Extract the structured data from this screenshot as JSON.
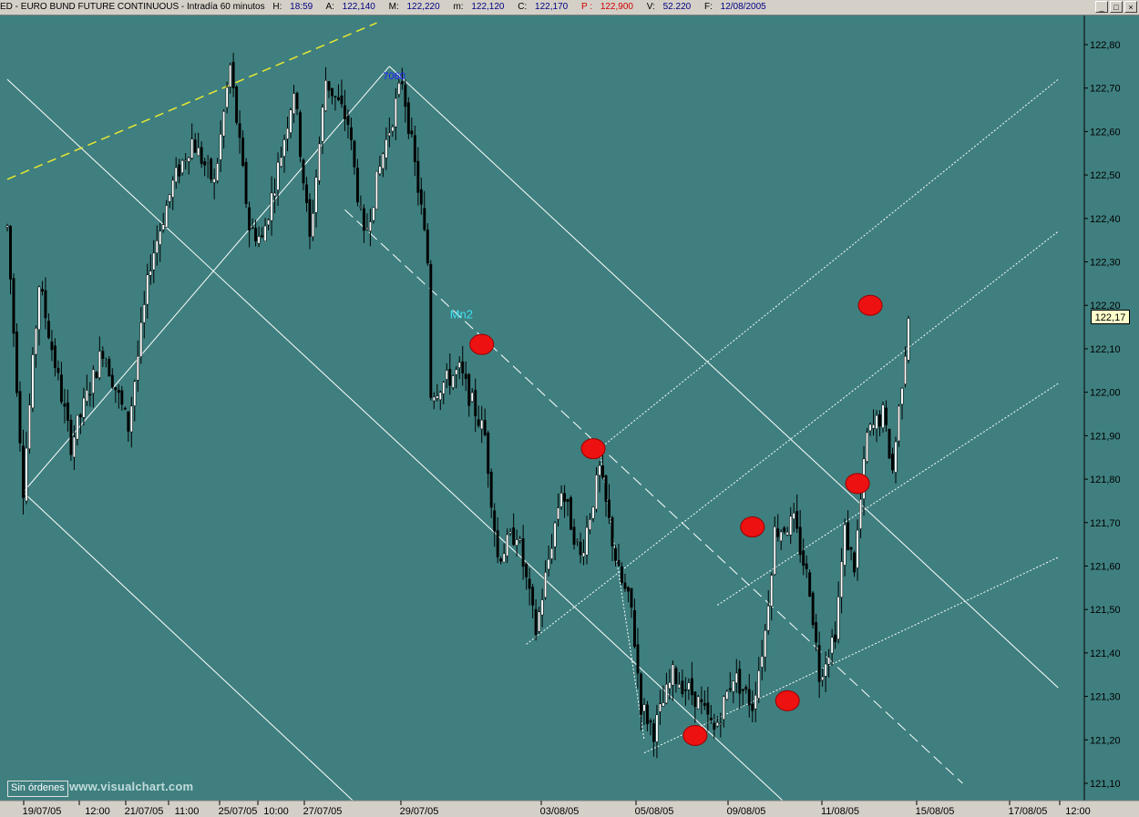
{
  "header": {
    "symbol": "ED - EURO BUND FUTURE CONTINUOUS - Intradía 60 minutos",
    "h_label": "H:",
    "h_value": "18:59",
    "a_label": "A:",
    "a_value": "122,140",
    "m_label": "M:",
    "m_value": "122,220",
    "mi_label": "m:",
    "mi_value": "122,120",
    "c_label": "C:",
    "c_value": "122,170",
    "p_label": "P :",
    "p_value": "122,900",
    "v_label": "V:",
    "v_value": "52.220",
    "f_label": "F:",
    "f_value": "12/08/2005"
  },
  "window_buttons": {
    "minimize": "_",
    "maximize": "□",
    "close": "×"
  },
  "footer": {
    "orders_button": "Sin órdenes",
    "watermark": "www.visualchart.com"
  },
  "last_price_tag": "122,17",
  "colors": {
    "background": "#3f7f7f",
    "candle_up": "#ffffff",
    "candle_down": "#000000",
    "channel_lines": "#ffffff",
    "yellow_line": "#e8e830",
    "marker": "#ee1111",
    "annotation": "#40e0f0",
    "pivot_label": "#2020ff"
  },
  "chart_data": {
    "type": "candlestick",
    "y_axis": {
      "min": 121.07,
      "max": 122.87,
      "ticks": [
        "122,80",
        "122,70",
        "122,60",
        "122,50",
        "122,40",
        "122,30",
        "122,20",
        "122,10",
        "122,00",
        "121,90",
        "121,80",
        "121,70",
        "121,60",
        "121,50",
        "121,40",
        "121,30",
        "121,20",
        "121,10"
      ]
    },
    "x_axis": {
      "ticks": [
        "19/07/05",
        "12:00",
        "21/07/05",
        "11:00",
        "25/07/05",
        "10:00",
        "27/07/05",
        "29/07/05",
        "03/08/05",
        "05/08/05",
        "09/08/05",
        "11/08/05",
        "15/08/05",
        "17/08/05",
        "12:00"
      ]
    },
    "trend_path": [
      {
        "bar": 0,
        "p": 122.38
      },
      {
        "bar": 5,
        "p": 121.78
      },
      {
        "bar": 10,
        "p": 122.25
      },
      {
        "bar": 20,
        "p": 121.88
      },
      {
        "bar": 30,
        "p": 122.1
      },
      {
        "bar": 38,
        "p": 121.92
      },
      {
        "bar": 45,
        "p": 122.3
      },
      {
        "bar": 52,
        "p": 122.48
      },
      {
        "bar": 58,
        "p": 122.58
      },
      {
        "bar": 65,
        "p": 122.48
      },
      {
        "bar": 70,
        "p": 122.75
      },
      {
        "bar": 76,
        "p": 122.38
      },
      {
        "bar": 80,
        "p": 122.35
      },
      {
        "bar": 86,
        "p": 122.55
      },
      {
        "bar": 90,
        "p": 122.7
      },
      {
        "bar": 95,
        "p": 122.35
      },
      {
        "bar": 100,
        "p": 122.72
      },
      {
        "bar": 107,
        "p": 122.62
      },
      {
        "bar": 112,
        "p": 122.35
      },
      {
        "bar": 118,
        "p": 122.55
      },
      {
        "bar": 124,
        "p": 122.72
      },
      {
        "bar": 130,
        "p": 122.42
      },
      {
        "bar": 132,
        "p": 122.3
      },
      {
        "bar": 133,
        "p": 122.0
      },
      {
        "bar": 142,
        "p": 122.05
      },
      {
        "bar": 150,
        "p": 121.9
      },
      {
        "bar": 154,
        "p": 121.62
      },
      {
        "bar": 160,
        "p": 121.68
      },
      {
        "bar": 166,
        "p": 121.45
      },
      {
        "bar": 174,
        "p": 121.78
      },
      {
        "bar": 180,
        "p": 121.62
      },
      {
        "bar": 186,
        "p": 121.82
      },
      {
        "bar": 192,
        "p": 121.58
      },
      {
        "bar": 196,
        "p": 121.5
      },
      {
        "bar": 199,
        "p": 121.28
      },
      {
        "bar": 203,
        "p": 121.22
      },
      {
        "bar": 209,
        "p": 121.35
      },
      {
        "bar": 216,
        "p": 121.3
      },
      {
        "bar": 222,
        "p": 121.22
      },
      {
        "bar": 228,
        "p": 121.35
      },
      {
        "bar": 234,
        "p": 121.28
      },
      {
        "bar": 238,
        "p": 121.45
      },
      {
        "bar": 241,
        "p": 121.68
      },
      {
        "bar": 247,
        "p": 121.7
      },
      {
        "bar": 252,
        "p": 121.55
      },
      {
        "bar": 255,
        "p": 121.35
      },
      {
        "bar": 260,
        "p": 121.45
      },
      {
        "bar": 263,
        "p": 121.68
      },
      {
        "bar": 266,
        "p": 121.6
      },
      {
        "bar": 270,
        "p": 121.9
      },
      {
        "bar": 275,
        "p": 121.95
      },
      {
        "bar": 278,
        "p": 121.82
      },
      {
        "bar": 283,
        "p": 122.17
      }
    ],
    "bar_count": 284,
    "seed": 7,
    "channel_lines": [
      {
        "style": "solid",
        "p1": {
          "bar": 5,
          "p": 121.77
        },
        "p2": {
          "bar": 120,
          "p": 122.75
        }
      },
      {
        "style": "solid",
        "p1": {
          "bar": 120,
          "p": 122.75
        },
        "p2": {
          "bar": 330,
          "p": 121.32
        }
      },
      {
        "style": "solid",
        "p1": {
          "bar": 0,
          "p": 122.72
        },
        "p2": {
          "bar": 245,
          "p": 121.05
        }
      },
      {
        "style": "solid",
        "p1": {
          "bar": 5,
          "p": 121.77
        },
        "p2": {
          "bar": 110,
          "p": 121.05
        }
      },
      {
        "style": "dashed",
        "p1": {
          "bar": 106,
          "p": 122.42
        },
        "p2": {
          "bar": 300,
          "p": 121.1
        }
      },
      {
        "style": "dotted",
        "p1": {
          "bar": 163,
          "p": 121.42
        },
        "p2": {
          "bar": 330,
          "p": 122.37
        }
      },
      {
        "style": "dotted",
        "p1": {
          "bar": 186,
          "p": 121.87
        },
        "p2": {
          "bar": 330,
          "p": 122.72
        }
      },
      {
        "style": "dotted",
        "p1": {
          "bar": 200,
          "p": 121.17
        },
        "p2": {
          "bar": 330,
          "p": 121.62
        }
      },
      {
        "style": "dotted",
        "p1": {
          "bar": 186,
          "p": 121.87
        },
        "p2": {
          "bar": 200,
          "p": 121.2
        }
      },
      {
        "style": "dotted",
        "p1": {
          "bar": 223,
          "p": 121.51
        },
        "p2": {
          "bar": 330,
          "p": 122.02
        }
      },
      {
        "style": "yellow",
        "p1": {
          "bar": 0,
          "p": 122.49
        },
        "p2": {
          "bar": 116,
          "p": 122.85
        }
      }
    ],
    "markers": [
      {
        "bar": 149,
        "p": 122.11
      },
      {
        "bar": 184,
        "p": 121.87
      },
      {
        "bar": 216,
        "p": 121.21
      },
      {
        "bar": 234,
        "p": 121.69
      },
      {
        "bar": 245,
        "p": 121.29
      },
      {
        "bar": 267,
        "p": 121.79
      },
      {
        "bar": 271,
        "p": 122.2
      }
    ],
    "annotations": [
      {
        "text": "Mn2",
        "bar": 139,
        "p": 122.17
      },
      {
        "text": "7060",
        "bar": 118,
        "p": 122.72
      }
    ]
  }
}
